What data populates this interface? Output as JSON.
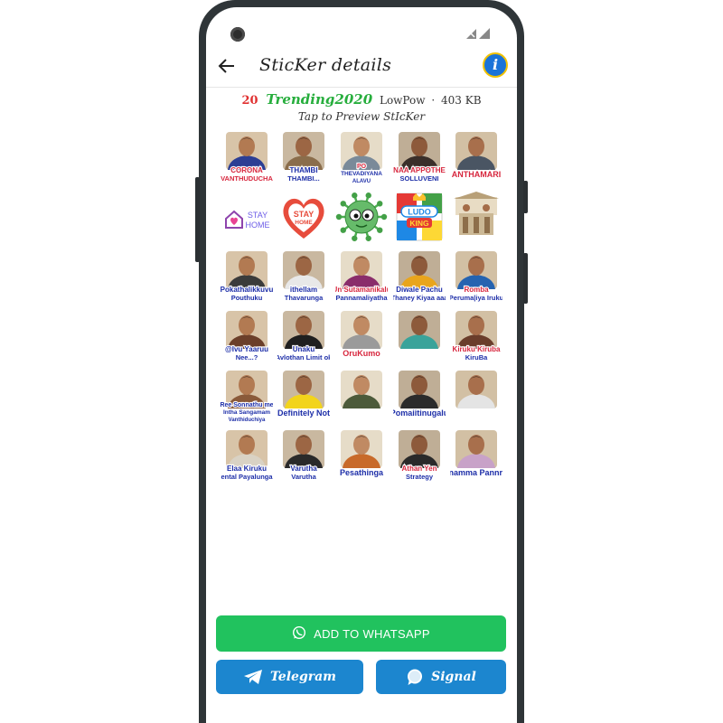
{
  "appbar": {
    "title": "SticKer details",
    "info_icon": "i"
  },
  "pack": {
    "count": "20",
    "name": "Trending2020",
    "publisher": "LowPow",
    "separator": "·",
    "size": "403 KB",
    "tap_hint": "Tap to Preview StIcKer"
  },
  "stickers": [
    {
      "caption1": "CORONA",
      "caption2": "VANTHUDUCHA",
      "kind": "photo",
      "shirt": "#2c3e94",
      "c1": "#d7263d",
      "c2": "#d7263d"
    },
    {
      "caption1": "THAMBI",
      "caption2": "THAMBI...",
      "kind": "photo",
      "shirt": "#8a6d4b",
      "c1": "#1d2ea8",
      "c2": "#1d2ea8"
    },
    {
      "caption1": "PO",
      "caption2": "THEVADIYANA",
      "caption3": "ALAVU",
      "kind": "photo",
      "shirt": "#7a8a99",
      "c1": "#d7263d",
      "c2": "#1d2ea8"
    },
    {
      "caption1": "NAA APPOTHE",
      "caption2": "SOLLUVENI",
      "kind": "photo",
      "shirt": "#3a2f2a",
      "c1": "#d7263d",
      "c2": "#1d2ea8"
    },
    {
      "caption1": "ANTHAMARI",
      "caption2": "",
      "kind": "photo",
      "shirt": "#4a5563",
      "c1": "#d7263d",
      "c2": "#d7263d"
    },
    {
      "caption1": "STAY",
      "caption2": "HOME",
      "kind": "stayhome"
    },
    {
      "caption1": "STAY",
      "caption2": "HOME",
      "kind": "heart"
    },
    {
      "caption1": "",
      "caption2": "",
      "kind": "virus"
    },
    {
      "caption1": "LUDO",
      "caption2": "KING",
      "kind": "ludo"
    },
    {
      "caption1": "",
      "caption2": "",
      "kind": "scene"
    },
    {
      "caption1": "Pokathalikkuvu",
      "caption2": "Pouthuku",
      "kind": "photo",
      "shirt": "#3b3b3b",
      "c1": "#1d2ea8",
      "c2": "#1d2ea8"
    },
    {
      "caption1": "ithellam",
      "caption2": "Thavarunga",
      "kind": "photo",
      "shirt": "#e8e8e8",
      "c1": "#1d2ea8",
      "c2": "#1d2ea8"
    },
    {
      "caption1": "Un Sutamanikalu",
      "caption2": "Pannamaliyatha",
      "kind": "photo",
      "shirt": "#8a2d6b",
      "c1": "#d7263d",
      "c2": "#1d2ea8"
    },
    {
      "caption1": "Diwale Pachu",
      "caption2": "Thaney Kiyaa aaa",
      "kind": "photo",
      "shirt": "#e9a51c",
      "c1": "#1d2ea8",
      "c2": "#1d2ea8"
    },
    {
      "caption1": "Romba",
      "caption2": "Peruma|iya Iruku",
      "kind": "photo",
      "shirt": "#2563b0",
      "c1": "#d7263d",
      "c2": "#1d2ea8"
    },
    {
      "caption1": "@Ivu Yaaruu",
      "caption2": "Nee...?",
      "kind": "photo",
      "shirt": "#6b3f2a",
      "c1": "#1d2ea8",
      "c2": "#1d2ea8"
    },
    {
      "caption1": "Unaku",
      "caption2": "Avlothan Limit ok",
      "kind": "photo",
      "shirt": "#1f1f1f",
      "c1": "#1d2ea8",
      "c2": "#1d2ea8"
    },
    {
      "caption1": "OruKumo",
      "caption2": "",
      "kind": "photo",
      "shirt": "#9a9a9a",
      "c1": "#d7263d",
      "c2": "#d7263d"
    },
    {
      "caption1": "",
      "caption2": "",
      "kind": "photo",
      "shirt": "#3aa39a",
      "c1": "#1d2ea8",
      "c2": "#1d2ea8"
    },
    {
      "caption1": "Kiruku Kiruba",
      "caption2": "KiruBa",
      "kind": "photo",
      "shirt": "#6a3d2b",
      "c1": "#d7263d",
      "c2": "#1d2ea8"
    },
    {
      "caption1": "Ree Sonnathu me",
      "caption2": "Intha Sangamam",
      "caption3": "Vanthiduchiya",
      "kind": "photo",
      "shirt": "#8a5a3a",
      "c1": "#1d2ea8",
      "c2": "#1d2ea8"
    },
    {
      "caption1": "Definitely Not",
      "caption2": "",
      "kind": "photo",
      "shirt": "#f2d41b",
      "c1": "#1d2ea8",
      "c2": "#1d2ea8"
    },
    {
      "caption1": "",
      "caption2": "",
      "kind": "photo",
      "shirt": "#4c5a3a",
      "c1": "#1d2ea8",
      "c2": "#1d2ea8"
    },
    {
      "caption1": "Pomaiitinugalu",
      "caption2": "",
      "kind": "photo",
      "shirt": "#2b2b2b",
      "c1": "#1d2ea8",
      "c2": "#1d2ea8"
    },
    {
      "caption1": "",
      "caption2": "",
      "kind": "photo",
      "shirt": "#e4e4e4",
      "c1": "#1d2ea8",
      "c2": "#1d2ea8"
    },
    {
      "caption1": "Elaa Kiruku",
      "caption2": "Mental Payalungala",
      "kind": "photo",
      "shirt": "#d9d2c4",
      "c1": "#1d2ea8",
      "c2": "#1d2ea8"
    },
    {
      "caption1": "Varutha",
      "caption2": "Varutha",
      "kind": "photo",
      "shirt": "#2a2a2a",
      "c1": "#1d2ea8",
      "c2": "#1d2ea8"
    },
    {
      "caption1": "Pesathinga",
      "caption2": "",
      "kind": "photo",
      "shirt": "#c86a2a",
      "c1": "#1d2ea8",
      "c2": "#1d2ea8"
    },
    {
      "caption1": "Athan Yen",
      "caption2": "Strategy",
      "kind": "photo",
      "shirt": "#2a2a2a",
      "c1": "#d7263d",
      "c2": "#1d2ea8"
    },
    {
      "caption1": "Ennamma Pannriko",
      "caption2": "",
      "kind": "photo",
      "shirt": "#c8a2c8",
      "c1": "#1d2ea8",
      "c2": "#1d2ea8"
    }
  ],
  "buttons": {
    "whatsapp": "ADD TO WHATSAPP",
    "telegram": "Telegram",
    "signal": "Signal"
  },
  "colors": {
    "whatsapp_green": "#21c25e",
    "blue_button": "#1c86cf",
    "pack_name_green": "#27ae3d",
    "count_red": "#e03131"
  },
  "icons": {
    "back": "arrow-left",
    "info": "info-circle",
    "whatsapp": "whatsapp-logo",
    "telegram": "paper-plane",
    "signal": "signal-bubble"
  }
}
